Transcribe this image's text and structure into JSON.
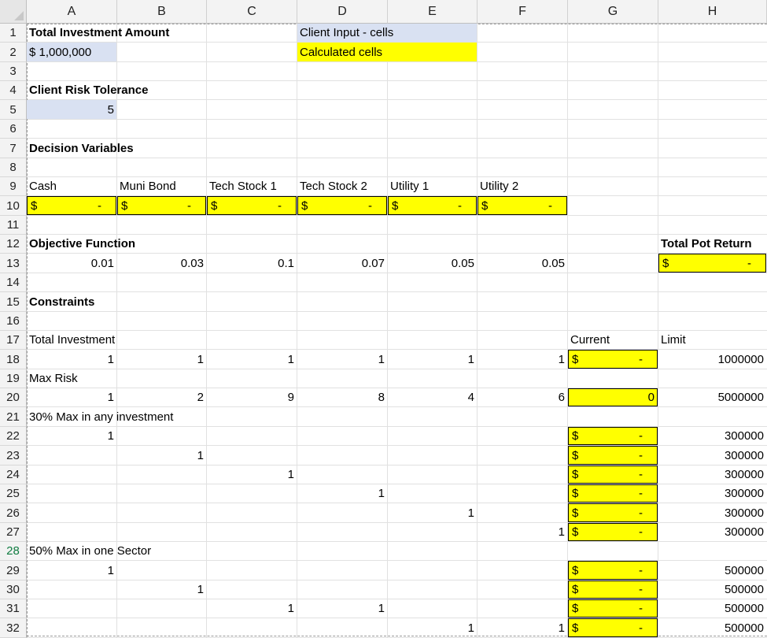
{
  "columns": [
    "A",
    "B",
    "C",
    "D",
    "E",
    "F",
    "G",
    "H"
  ],
  "rows": [
    "1",
    "2",
    "3",
    "4",
    "5",
    "6",
    "7",
    "8",
    "9",
    "10",
    "11",
    "12",
    "13",
    "14",
    "15",
    "16",
    "17",
    "18",
    "19",
    "20",
    "21",
    "22",
    "23",
    "24",
    "25",
    "26",
    "27",
    "28",
    "29",
    "30",
    "31",
    "32"
  ],
  "cells": {
    "A1": "Total Investment Amount",
    "A2": "$  1,000,000",
    "D1": "Client Input - cells",
    "D2": "Calculated cells",
    "A4": "Client Risk Tolerance",
    "A5": "5",
    "A7": "Decision Variables",
    "A9": "Cash",
    "B9": "Muni Bond",
    "C9": "Tech Stock 1",
    "D9": "Tech Stock 2",
    "E9": "Utility 1",
    "F9": "Utility 2",
    "A12": "Objective Function",
    "H12": "Total Pot Return",
    "A13": "0.01",
    "B13": "0.03",
    "C13": "0.1",
    "D13": "0.07",
    "E13": "0.05",
    "F13": "0.05",
    "A15": "Constraints",
    "A17": "Total Investment",
    "G17": "Current",
    "H17": "Limit",
    "A18": "1",
    "B18": "1",
    "C18": "1",
    "D18": "1",
    "E18": "1",
    "F18": "1",
    "H18": "1000000",
    "A19": "Max Risk",
    "A20": "1",
    "B20": "2",
    "C20": "9",
    "D20": "8",
    "E20": "4",
    "F20": "6",
    "G20": "0",
    "H20": "5000000",
    "A21": "30% Max in any investment",
    "A22": "1",
    "H22": "300000",
    "B23": "1",
    "H23": "300000",
    "C24": "1",
    "H24": "300000",
    "D25": "1",
    "H25": "300000",
    "E26": "1",
    "H26": "300000",
    "F27": "1",
    "H27": "300000",
    "A28": "50% Max in one Sector",
    "A29": "1",
    "H29": "500000",
    "B30": "1",
    "H30": "500000",
    "C31": "1",
    "D31": "1",
    "H31": "500000",
    "E32": "1",
    "F32": "1",
    "H32": "500000"
  },
  "accounting": {
    "symbol": "$",
    "dash": "-"
  },
  "colors": {
    "input": "#d9e1f2",
    "calculated": "#ffff00",
    "selected_row_header": "#107c41"
  }
}
